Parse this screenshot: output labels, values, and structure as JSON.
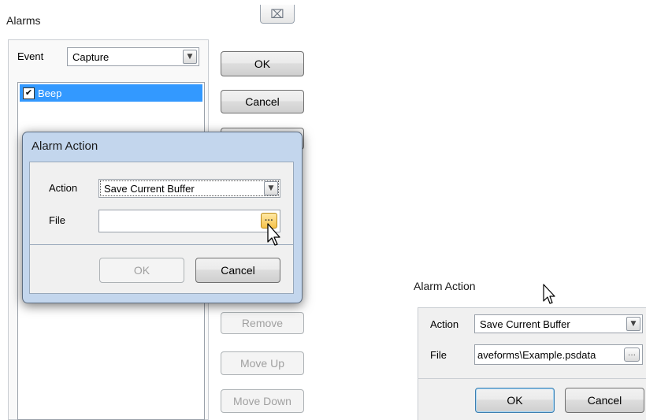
{
  "alarms": {
    "title": "Alarms",
    "close_glyph": "⌧",
    "event_label": "Event",
    "event_value": "Capture",
    "list_items": [
      {
        "label": "Beep",
        "checked": true
      }
    ],
    "buttons": {
      "ok": "OK",
      "cancel": "Cancel",
      "remove": "Remove",
      "move_up": "Move Up",
      "move_down": "Move Down"
    }
  },
  "dialog_front": {
    "title": "Alarm Action",
    "action_label": "Action",
    "action_value": "Save Current Buffer",
    "file_label": "File",
    "file_value": "",
    "browse_glyph": "···",
    "ok": "OK",
    "cancel": "Cancel"
  },
  "dialog_right": {
    "title": "Alarm Action",
    "action_label": "Action",
    "action_value": "Save Current Buffer",
    "file_label": "File",
    "file_value": "aveforms\\Example.psdata",
    "browse_glyph": "···",
    "ok": "OK",
    "cancel": "Cancel"
  }
}
